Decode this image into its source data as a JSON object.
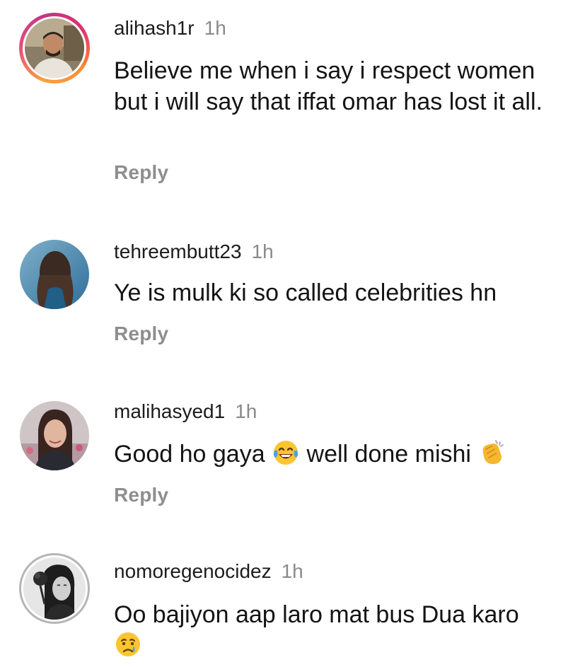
{
  "comments": [
    {
      "username": "alihash1r",
      "time": "1h",
      "text": "Believe me when i say i respect women but i will say that iffat omar has lost it all.",
      "reply_label": "Reply"
    },
    {
      "username": "tehreembutt23",
      "time": "1h",
      "text": "Ye is mulk ki so called celebrities hn",
      "reply_label": "Reply"
    },
    {
      "username": "malihasyed1",
      "time": "1h",
      "text_before_emoji": "Good ho gaya",
      "emoji_1": "laughing-tears-emoji",
      "text_after_emoji": "well done mishi",
      "emoji_2": "clapping-hands-emoji",
      "reply_label": "Reply"
    },
    {
      "username": "nomoregenocidez",
      "time": "1h",
      "text": "Oo bajiyon aap laro mat bus Dua karo",
      "emoji": "crying-face-emoji"
    }
  ],
  "colors": {
    "story_ring_start": "#f9a03f",
    "story_ring_mid": "#e1306c",
    "text": "#141414",
    "muted": "#8e8e8e"
  }
}
